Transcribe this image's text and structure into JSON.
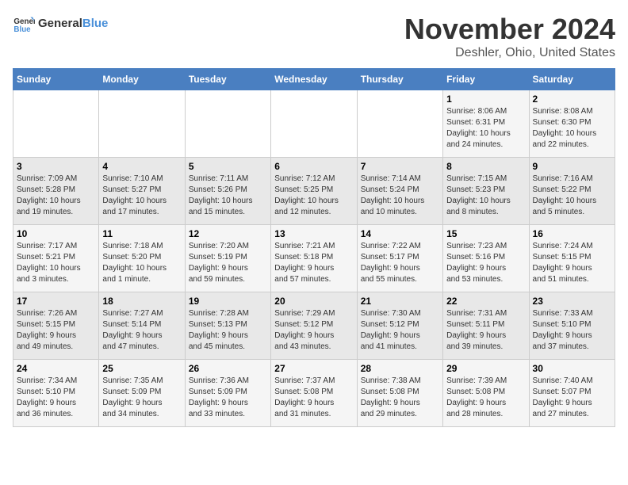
{
  "logo": {
    "text_general": "General",
    "text_blue": "Blue"
  },
  "title": {
    "month": "November 2024",
    "location": "Deshler, Ohio, United States"
  },
  "days_of_week": [
    "Sunday",
    "Monday",
    "Tuesday",
    "Wednesday",
    "Thursday",
    "Friday",
    "Saturday"
  ],
  "weeks": [
    [
      {
        "day": "",
        "info": ""
      },
      {
        "day": "",
        "info": ""
      },
      {
        "day": "",
        "info": ""
      },
      {
        "day": "",
        "info": ""
      },
      {
        "day": "",
        "info": ""
      },
      {
        "day": "1",
        "info": "Sunrise: 8:06 AM\nSunset: 6:31 PM\nDaylight: 10 hours\nand 24 minutes."
      },
      {
        "day": "2",
        "info": "Sunrise: 8:08 AM\nSunset: 6:30 PM\nDaylight: 10 hours\nand 22 minutes."
      }
    ],
    [
      {
        "day": "3",
        "info": "Sunrise: 7:09 AM\nSunset: 5:28 PM\nDaylight: 10 hours\nand 19 minutes."
      },
      {
        "day": "4",
        "info": "Sunrise: 7:10 AM\nSunset: 5:27 PM\nDaylight: 10 hours\nand 17 minutes."
      },
      {
        "day": "5",
        "info": "Sunrise: 7:11 AM\nSunset: 5:26 PM\nDaylight: 10 hours\nand 15 minutes."
      },
      {
        "day": "6",
        "info": "Sunrise: 7:12 AM\nSunset: 5:25 PM\nDaylight: 10 hours\nand 12 minutes."
      },
      {
        "day": "7",
        "info": "Sunrise: 7:14 AM\nSunset: 5:24 PM\nDaylight: 10 hours\nand 10 minutes."
      },
      {
        "day": "8",
        "info": "Sunrise: 7:15 AM\nSunset: 5:23 PM\nDaylight: 10 hours\nand 8 minutes."
      },
      {
        "day": "9",
        "info": "Sunrise: 7:16 AM\nSunset: 5:22 PM\nDaylight: 10 hours\nand 5 minutes."
      }
    ],
    [
      {
        "day": "10",
        "info": "Sunrise: 7:17 AM\nSunset: 5:21 PM\nDaylight: 10 hours\nand 3 minutes."
      },
      {
        "day": "11",
        "info": "Sunrise: 7:18 AM\nSunset: 5:20 PM\nDaylight: 10 hours\nand 1 minute."
      },
      {
        "day": "12",
        "info": "Sunrise: 7:20 AM\nSunset: 5:19 PM\nDaylight: 9 hours\nand 59 minutes."
      },
      {
        "day": "13",
        "info": "Sunrise: 7:21 AM\nSunset: 5:18 PM\nDaylight: 9 hours\nand 57 minutes."
      },
      {
        "day": "14",
        "info": "Sunrise: 7:22 AM\nSunset: 5:17 PM\nDaylight: 9 hours\nand 55 minutes."
      },
      {
        "day": "15",
        "info": "Sunrise: 7:23 AM\nSunset: 5:16 PM\nDaylight: 9 hours\nand 53 minutes."
      },
      {
        "day": "16",
        "info": "Sunrise: 7:24 AM\nSunset: 5:15 PM\nDaylight: 9 hours\nand 51 minutes."
      }
    ],
    [
      {
        "day": "17",
        "info": "Sunrise: 7:26 AM\nSunset: 5:15 PM\nDaylight: 9 hours\nand 49 minutes."
      },
      {
        "day": "18",
        "info": "Sunrise: 7:27 AM\nSunset: 5:14 PM\nDaylight: 9 hours\nand 47 minutes."
      },
      {
        "day": "19",
        "info": "Sunrise: 7:28 AM\nSunset: 5:13 PM\nDaylight: 9 hours\nand 45 minutes."
      },
      {
        "day": "20",
        "info": "Sunrise: 7:29 AM\nSunset: 5:12 PM\nDaylight: 9 hours\nand 43 minutes."
      },
      {
        "day": "21",
        "info": "Sunrise: 7:30 AM\nSunset: 5:12 PM\nDaylight: 9 hours\nand 41 minutes."
      },
      {
        "day": "22",
        "info": "Sunrise: 7:31 AM\nSunset: 5:11 PM\nDaylight: 9 hours\nand 39 minutes."
      },
      {
        "day": "23",
        "info": "Sunrise: 7:33 AM\nSunset: 5:10 PM\nDaylight: 9 hours\nand 37 minutes."
      }
    ],
    [
      {
        "day": "24",
        "info": "Sunrise: 7:34 AM\nSunset: 5:10 PM\nDaylight: 9 hours\nand 36 minutes."
      },
      {
        "day": "25",
        "info": "Sunrise: 7:35 AM\nSunset: 5:09 PM\nDaylight: 9 hours\nand 34 minutes."
      },
      {
        "day": "26",
        "info": "Sunrise: 7:36 AM\nSunset: 5:09 PM\nDaylight: 9 hours\nand 33 minutes."
      },
      {
        "day": "27",
        "info": "Sunrise: 7:37 AM\nSunset: 5:08 PM\nDaylight: 9 hours\nand 31 minutes."
      },
      {
        "day": "28",
        "info": "Sunrise: 7:38 AM\nSunset: 5:08 PM\nDaylight: 9 hours\nand 29 minutes."
      },
      {
        "day": "29",
        "info": "Sunrise: 7:39 AM\nSunset: 5:08 PM\nDaylight: 9 hours\nand 28 minutes."
      },
      {
        "day": "30",
        "info": "Sunrise: 7:40 AM\nSunset: 5:07 PM\nDaylight: 9 hours\nand 27 minutes."
      }
    ]
  ]
}
